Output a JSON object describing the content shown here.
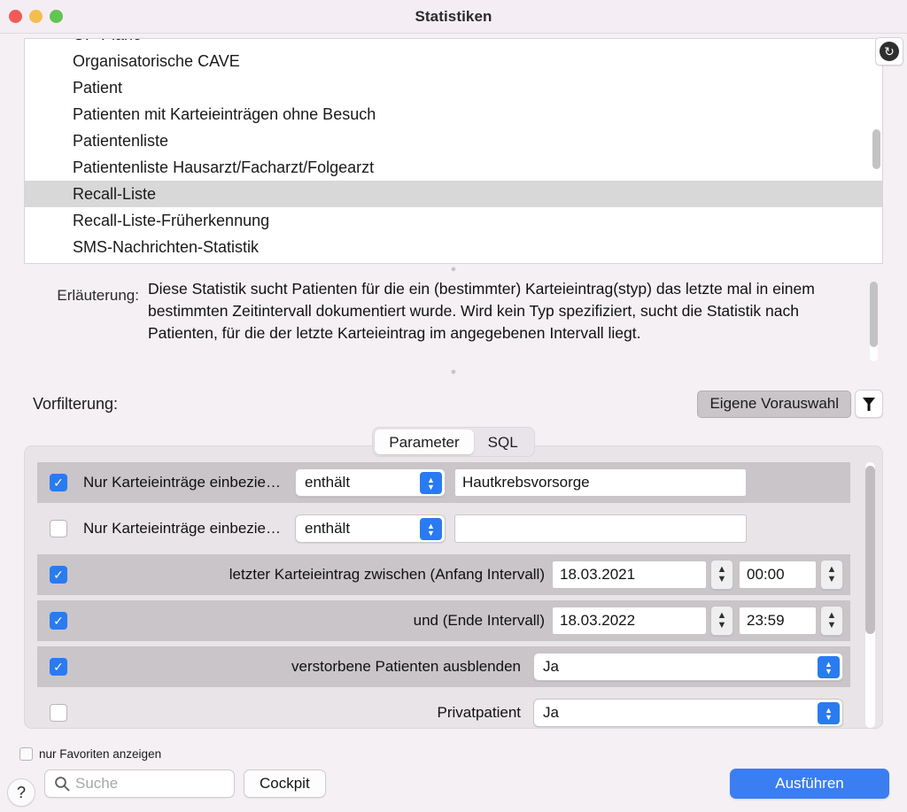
{
  "window": {
    "title": "Statistiken",
    "traffic_lights": [
      "close",
      "minimize",
      "zoom"
    ],
    "refresh_icon": "refresh-icon",
    "refresh_glyph": "↻"
  },
  "statistics_list": {
    "items": [
      {
        "label": "OP-Pläne",
        "selected": false,
        "clipped": true
      },
      {
        "label": "Organisatorische CAVE",
        "selected": false
      },
      {
        "label": "Patient",
        "selected": false
      },
      {
        "label": "Patienten mit Karteieinträgen ohne Besuch",
        "selected": false
      },
      {
        "label": "Patientenliste",
        "selected": false
      },
      {
        "label": "Patientenliste Hausarzt/Facharzt/Folgearzt",
        "selected": false
      },
      {
        "label": "Recall-Liste",
        "selected": true
      },
      {
        "label": "Recall-Liste-Früherkennung",
        "selected": false
      },
      {
        "label": "SMS-Nachrichten-Statistik",
        "selected": false,
        "clipped": true
      }
    ]
  },
  "explanation": {
    "label": "Erläuterung:",
    "text": "Diese Statistik sucht Patienten für die ein (bestimmter) Karteieintrag(styp) das letzte mal in einem bestimmten Zeitintervall dokumentiert wurde. Wird kein Typ spezifiziert, sucht die Statistik nach Patienten, für die der letzte Karteieintrag im angegebenen Intervall liegt."
  },
  "prefilter": {
    "label": "Vorfilterung:",
    "button_label": "Eigene Vorauswahl",
    "filter_icon": "funnel-icon"
  },
  "tabs": [
    {
      "label": "Parameter",
      "active": true
    },
    {
      "label": "SQL",
      "active": false
    }
  ],
  "parameters": {
    "rows": [
      {
        "kind": "text",
        "checked": true,
        "shaded": true,
        "label": "Nur Karteieinträge einbezie…",
        "operator": "enthält",
        "value": "Hautkrebsvorsorge",
        "align": "left"
      },
      {
        "kind": "text",
        "checked": false,
        "shaded": false,
        "label": "Nur Karteieinträge einbezie…",
        "operator": "enthält",
        "value": "",
        "align": "left"
      },
      {
        "kind": "datetime",
        "checked": true,
        "shaded": true,
        "label": "letzter Karteieintrag zwischen (Anfang Intervall)",
        "date": "18.03.2021",
        "time": "00:00",
        "align": "right"
      },
      {
        "kind": "datetime",
        "checked": true,
        "shaded": true,
        "label": "und (Ende Intervall)",
        "date": "18.03.2022",
        "time": "23:59",
        "align": "right"
      },
      {
        "kind": "select",
        "checked": true,
        "shaded": true,
        "label": "verstorbene Patienten ausblenden",
        "value": "Ja",
        "align": "right"
      },
      {
        "kind": "select",
        "checked": false,
        "shaded": false,
        "label": "Privatpatient",
        "value": "Ja",
        "align": "right",
        "clipped": true
      }
    ]
  },
  "bottom": {
    "favorites_label": "nur Favoriten anzeigen",
    "favorites_checked": false,
    "search_placeholder": "Suche",
    "search_value": "",
    "search_icon": "search-icon",
    "cockpit_label": "Cockpit",
    "run_label": "Ausführen",
    "help_label": "?"
  },
  "colors": {
    "accent_blue": "#3b7ef2",
    "checkbox_blue": "#2a7bf0",
    "window_bg": "#f4f0f4",
    "row_shaded": "#c9c5c9",
    "selected_row": "#d8d8d8"
  }
}
